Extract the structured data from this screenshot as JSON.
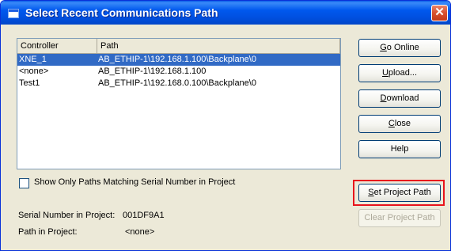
{
  "window": {
    "title": "Select Recent Communications Path",
    "close_glyph": "✕"
  },
  "table": {
    "columns": [
      "Controller",
      "Path"
    ],
    "rows": [
      {
        "controller": "XNE_1",
        "path": "AB_ETHIP-1\\192.168.1.100\\Backplane\\0",
        "selected": true
      },
      {
        "controller": "<none>",
        "path": "AB_ETHIP-1\\192.168.1.100",
        "selected": false
      },
      {
        "controller": "Test1",
        "path": "AB_ETHIP-1\\192.168.0.100\\Backplane\\0",
        "selected": false
      }
    ]
  },
  "options": {
    "show_only_matching_label": "Show Only Paths Matching Serial Number in Project",
    "show_only_matching_checked": false
  },
  "info": {
    "serial_label": "Serial Number in Project:",
    "serial_value": "001DF9A1",
    "path_label": "Path in Project:",
    "path_value": "<none>"
  },
  "buttons": {
    "go_online": {
      "key": "G",
      "rest": "o Online"
    },
    "upload": {
      "key": "U",
      "rest": "pload..."
    },
    "download": {
      "key": "D",
      "rest": "ownload"
    },
    "close": {
      "key": "C",
      "rest": "lose"
    },
    "help": "Help",
    "set_project_path": {
      "key": "S",
      "rest": "et Project Path"
    },
    "clear_project_path": "Clear Project Path"
  },
  "colors": {
    "selection": "#316ac5",
    "highlight_box": "#e8141c",
    "title_bar": "#0058ee"
  }
}
